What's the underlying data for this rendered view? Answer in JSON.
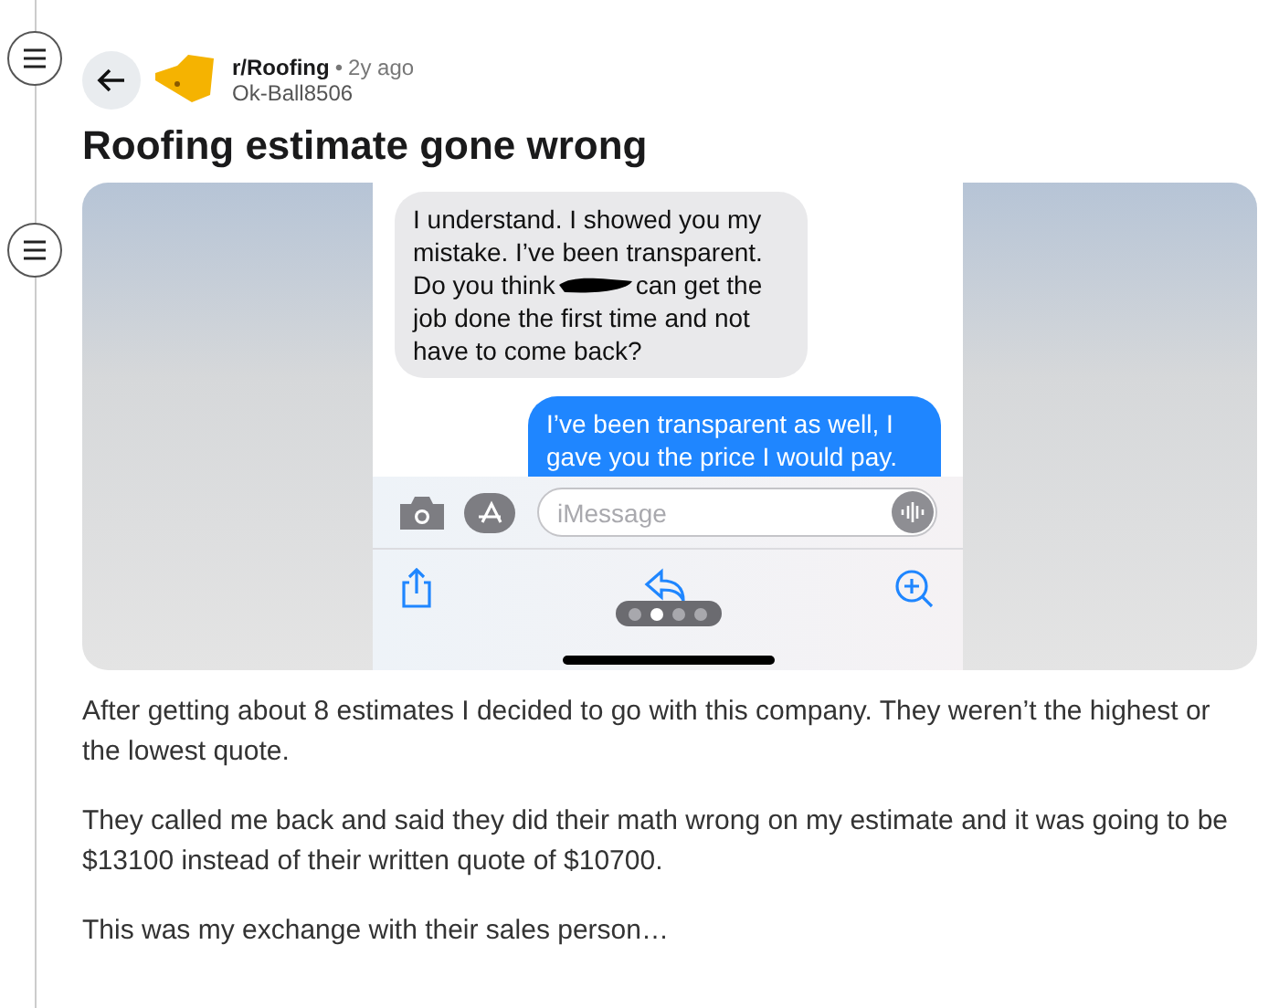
{
  "post": {
    "subreddit": "r/Roofing",
    "separator": "•",
    "age": "2y ago",
    "author": "Ok-Ball8506",
    "title": "Roofing estimate gone wrong"
  },
  "screenshot": {
    "received": [
      "I understand. I showed you my mistake. I’ve been transparent.",
      "Do you think",
      "can get the",
      "job done the first time and not have to come back?"
    ],
    "sent": "I’ve been transparent as well, I gave you the price I would pay.",
    "input": {
      "placeholder": "iMessage"
    },
    "page_dots": [
      {
        "selected": false
      },
      {
        "selected": true
      },
      {
        "selected": false
      },
      {
        "selected": false
      }
    ]
  },
  "body": [
    "After getting about 8 estimates I decided to go with this company. They weren’t the highest or the lowest quote.",
    "They called me back and said they did their math wrong on my estimate and it was going to be $13100 instead of their written quote of $10700.",
    "This was my exchange with their sales person…"
  ]
}
